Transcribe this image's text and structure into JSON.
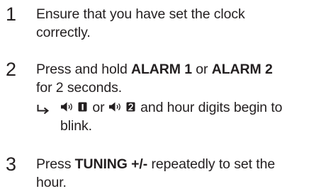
{
  "steps": [
    {
      "number": "1",
      "line1": "Ensure that you have set the clock",
      "line2": "correctly."
    },
    {
      "number": "2",
      "pre": "Press and hold ",
      "kw1": "ALARM 1",
      "mid": " or ",
      "kw2": "ALARM 2",
      "line2": "for 2 seconds.",
      "result": {
        "arrow_icon": "result-arrow-icon",
        "alarm1_icon": "alarm-1-icon",
        "sep": " or ",
        "alarm2_icon": "alarm-2-icon",
        "line1_tail": " and hour digits begin to",
        "line2": "blink."
      }
    },
    {
      "number": "3",
      "pre": "Press ",
      "kw": "TUNING +/-",
      "post": " repeatedly to set the",
      "line2": "hour."
    }
  ],
  "colors": {
    "text": "#231f20"
  }
}
